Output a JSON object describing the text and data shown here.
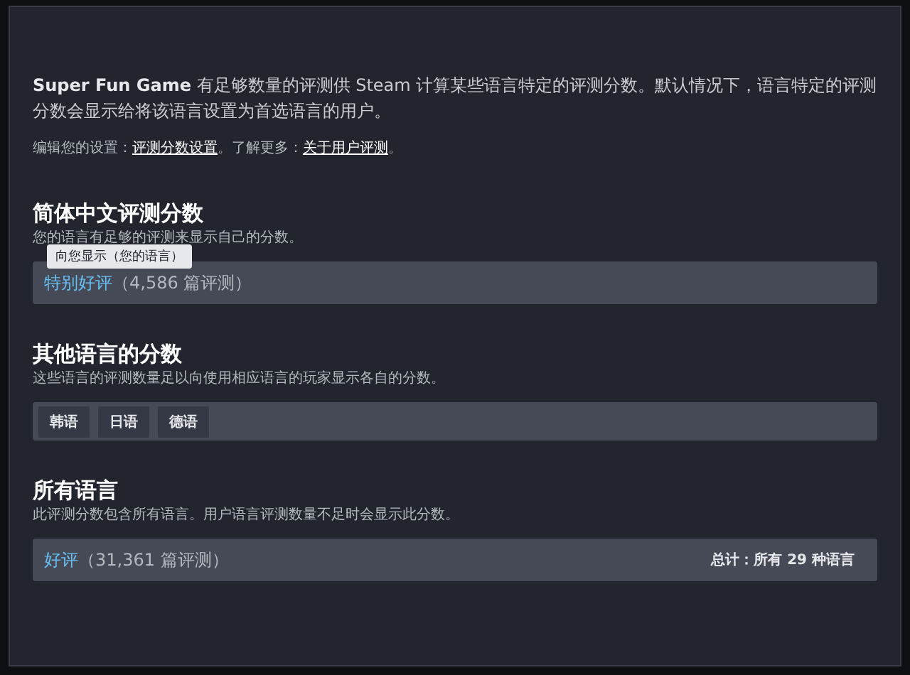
{
  "intro": "**Super Fun Game** 有足够数量的评测供 Steam 计算某些语言特定的评测分数。默认情况下，语言特定的评测分数会显示给将该语言设置为首选语言的用户。",
  "settings_line": {
    "parts": [
      {
        "kind": "text",
        "text": "编辑您的设置："
      },
      {
        "kind": "link",
        "text": "评测分数设置"
      },
      {
        "kind": "text",
        "text": "。了解更多："
      },
      {
        "kind": "link",
        "text": "关于用户评测"
      },
      {
        "kind": "text",
        "text": "。"
      }
    ]
  },
  "sections": [
    {
      "title": "简体中文评测分数",
      "subtitle": "您的语言有足够的评测来显示自己的分数。",
      "kind": "score",
      "tooltip": "向您显示（您的语言）",
      "rating": "特别好评",
      "count": "（4,586 篇评测）"
    },
    {
      "title": "其他语言的分数",
      "subtitle": "这些语言的评测数量足以向使用相应语言的玩家显示各自的分数。",
      "kind": "languages",
      "languages": [
        "韩语",
        "日语",
        "德语"
      ]
    },
    {
      "title": "所有语言",
      "subtitle": "此评测分数包含所有语言。用户语言评测数量不足时会显示此分数。",
      "kind": "score",
      "rating": "好评",
      "count": "（31,361 篇评测）",
      "total": "总计：所有 29 种语言"
    }
  ]
}
